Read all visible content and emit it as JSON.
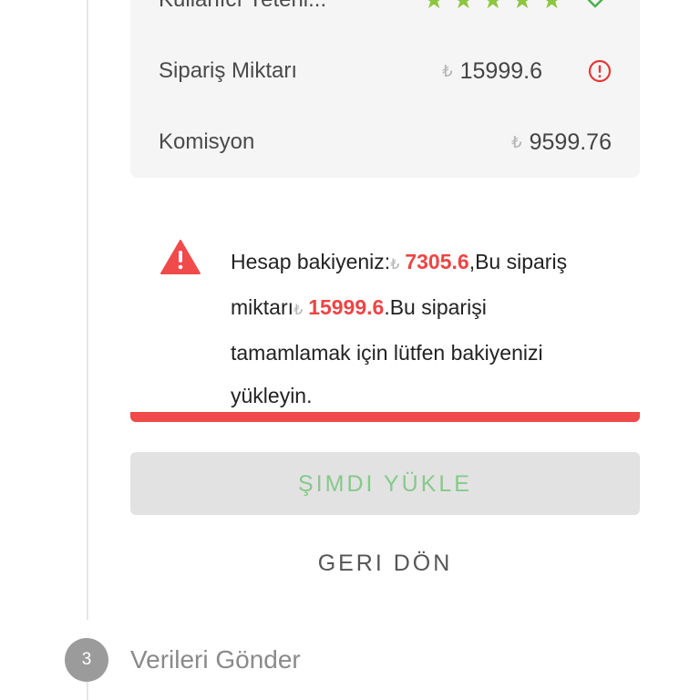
{
  "details": {
    "rating_row": {
      "label": "Kullanıcı Yeterli...",
      "stars": [
        "★",
        "★",
        "★",
        "★",
        "★"
      ],
      "status_icon": "double-check-icon",
      "rating": 5
    },
    "order_amount": {
      "label": "Sipariş Miktarı",
      "currency": "₺",
      "value": "15999.6",
      "status_icon": "alert-circle-icon"
    },
    "commission": {
      "label": "Komisyon",
      "currency": "₺",
      "value": "9599.76"
    }
  },
  "warning": {
    "icon": "warning-triangle-icon",
    "part1": "Hesap bakiyeniz:",
    "currency": "₺",
    "balance": "7305.6",
    "part2": ",Bu sipariş miktarı",
    "order_amount": "15999.6",
    "part3": ".Bu siparişi tamamlamak için lütfen bakiyenizi yükleyin."
  },
  "actions": {
    "primary_label": "ŞIMDI YÜKLE",
    "secondary_label": "GERI DÖN"
  },
  "step": {
    "number": "3",
    "title": "Verileri Gönder"
  },
  "colors": {
    "accent_green": "#86c98a",
    "star_green": "#8cc63f",
    "alert_red": "#ee4444",
    "warning_bar": "#f04a4a"
  }
}
